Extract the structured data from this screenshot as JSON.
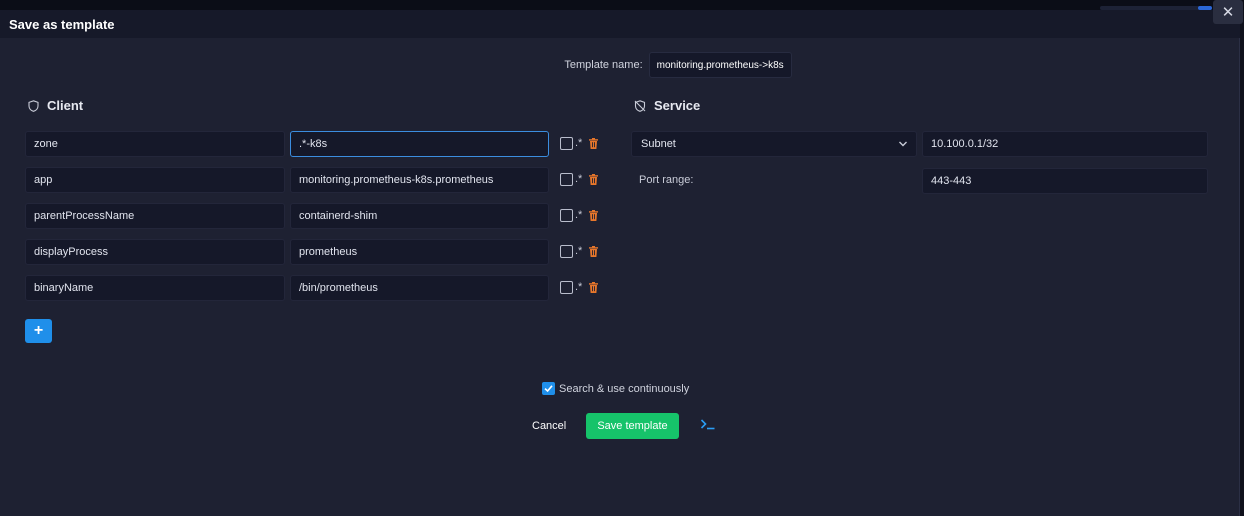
{
  "dialog": {
    "title": "Save as template",
    "close_label": "✕"
  },
  "template_name": {
    "label": "Template name:",
    "value": "monitoring.prometheus->k8s"
  },
  "client": {
    "heading": "Client",
    "rows": [
      {
        "key": "zone",
        "value": ".*-k8s",
        "regex_label": ".*"
      },
      {
        "key": "app",
        "value": "monitoring.prometheus-k8s.prometheus",
        "regex_label": ".*"
      },
      {
        "key": "parentProcessName",
        "value": "containerd-shim",
        "regex_label": ".*"
      },
      {
        "key": "displayProcess",
        "value": "prometheus",
        "regex_label": ".*"
      },
      {
        "key": "binaryName",
        "value": "/bin/prometheus",
        "regex_label": ".*"
      }
    ],
    "add_label": "+"
  },
  "service": {
    "heading": "Service",
    "type_selected": "Subnet",
    "subnet_value": "10.100.0.1/32",
    "port_label": "Port range:",
    "port_value": "443-443"
  },
  "footer": {
    "continuous_label": "Search & use continuously",
    "continuous_checked": true,
    "cancel_label": "Cancel",
    "save_label": "Save template"
  },
  "colors": {
    "background": "#1e2132",
    "titlebar": "#161929",
    "input_bg": "#151829",
    "accent_blue": "#1f8fea",
    "save_green": "#16c36a",
    "trash_orange": "#e8772b"
  }
}
